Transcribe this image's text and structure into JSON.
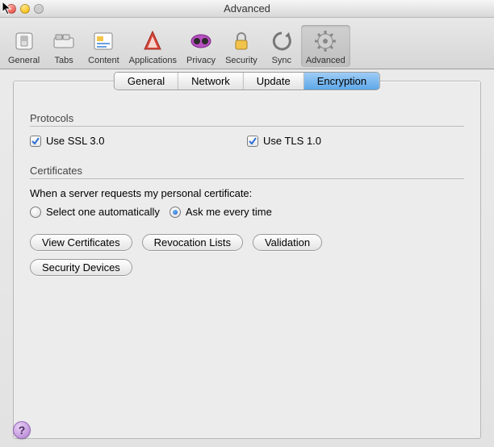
{
  "window": {
    "title": "Advanced"
  },
  "toolbar": {
    "items": [
      {
        "label": "General",
        "icon": "switch-icon"
      },
      {
        "label": "Tabs",
        "icon": "tabs-icon"
      },
      {
        "label": "Content",
        "icon": "content-icon"
      },
      {
        "label": "Applications",
        "icon": "applications-icon"
      },
      {
        "label": "Privacy",
        "icon": "privacy-icon"
      },
      {
        "label": "Security",
        "icon": "lock-icon"
      },
      {
        "label": "Sync",
        "icon": "sync-icon"
      },
      {
        "label": "Advanced",
        "icon": "gear-icon",
        "selected": true
      }
    ]
  },
  "subtabs": {
    "items": [
      {
        "label": "General"
      },
      {
        "label": "Network"
      },
      {
        "label": "Update"
      },
      {
        "label": "Encryption",
        "active": true
      }
    ]
  },
  "protocols": {
    "heading": "Protocols",
    "ssl": {
      "label": "Use SSL 3.0",
      "checked": true
    },
    "tls": {
      "label": "Use TLS 1.0",
      "checked": true
    }
  },
  "certificates": {
    "heading": "Certificates",
    "desc": "When a server requests my personal certificate:",
    "radios": {
      "auto": {
        "label": "Select one automatically",
        "checked": false
      },
      "ask": {
        "label": "Ask me every time",
        "checked": true
      }
    },
    "buttons": {
      "view": "View Certificates",
      "revoke": "Revocation Lists",
      "valid": "Validation",
      "devices": "Security Devices"
    }
  },
  "help": {
    "label": "?"
  }
}
